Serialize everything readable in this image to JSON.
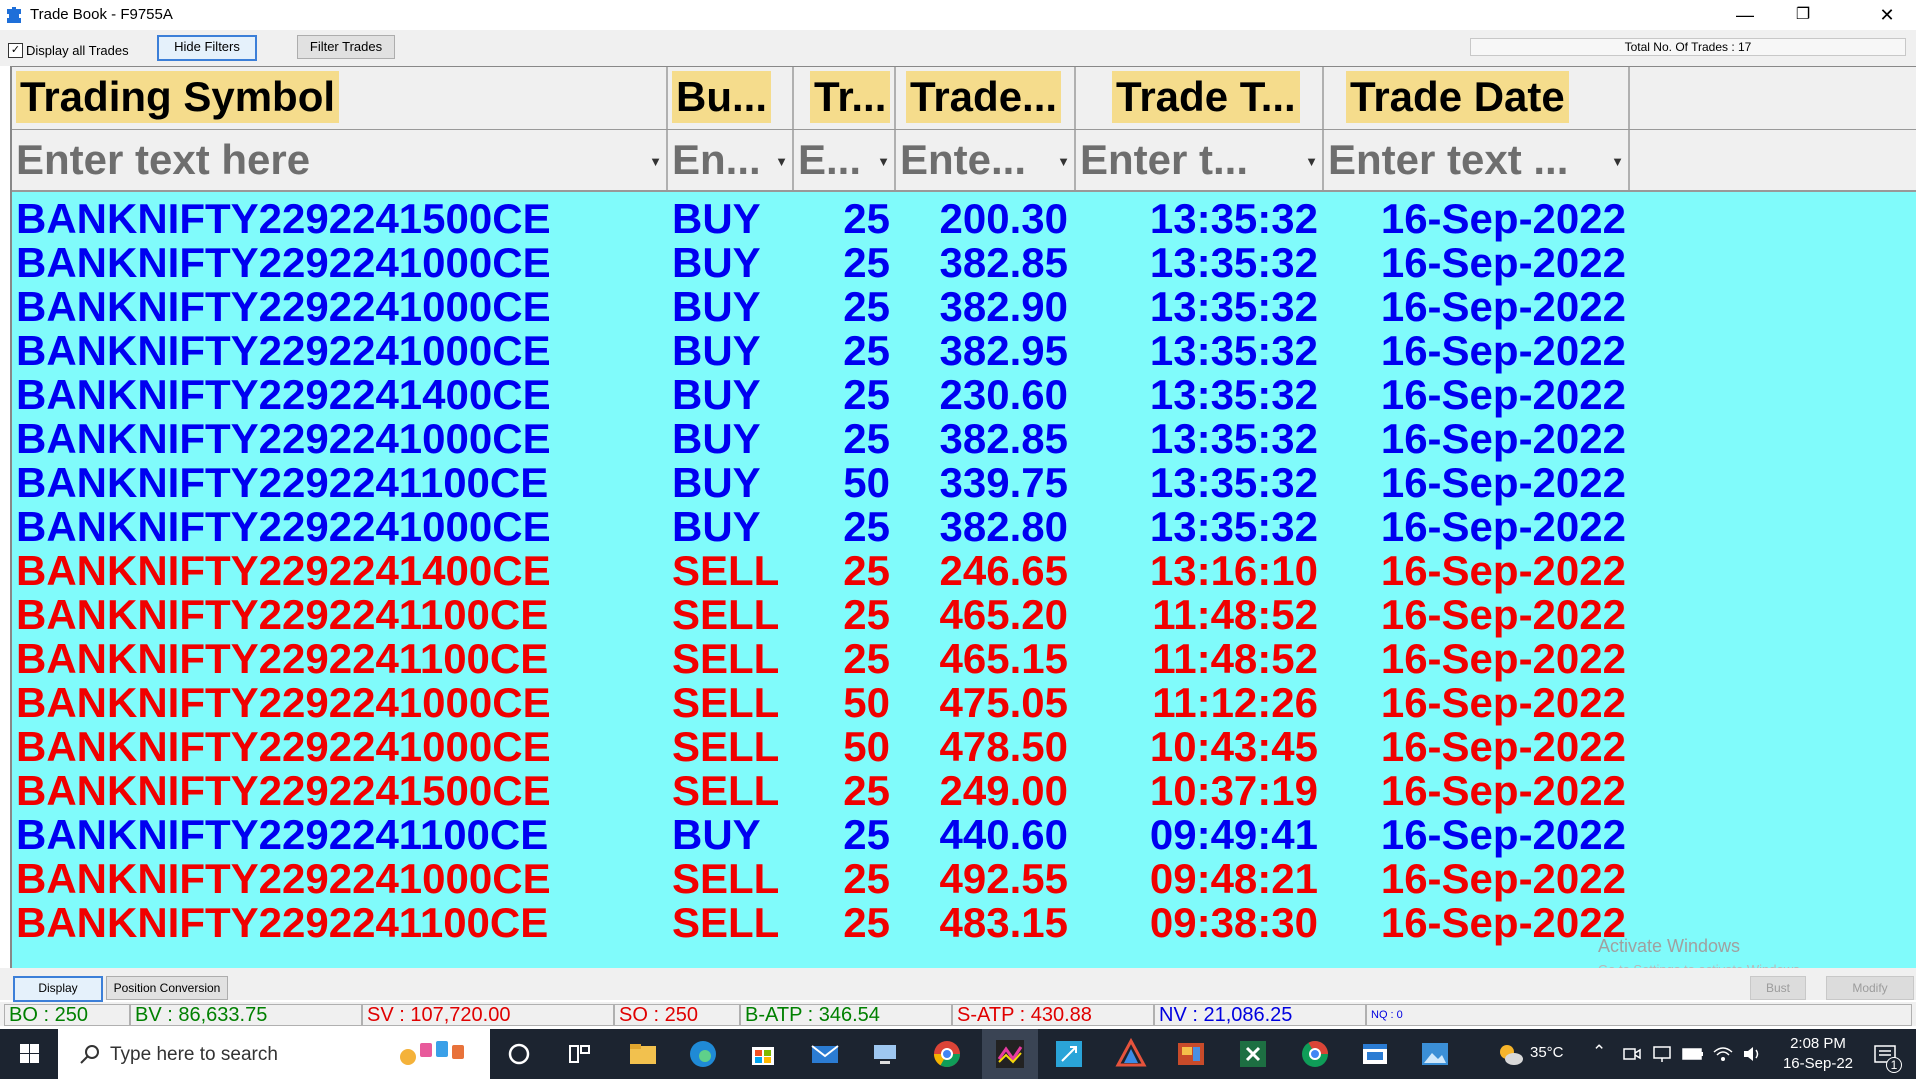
{
  "window": {
    "title": "Trade Book - F9755A",
    "minimize_glyph": "—",
    "maximize_glyph": "❐",
    "close_glyph": "✕"
  },
  "toolbar": {
    "display_all_label": "Display all Trades",
    "display_all_checked": true,
    "hide_filters_label": "Hide Filters",
    "filter_trades_label": "Filter Trades",
    "total_trades_text": "Total No. Of Trades : 17"
  },
  "columns": [
    {
      "header": "Trading Symbol",
      "filter_placeholder": "Enter text here"
    },
    {
      "header": "Bu...",
      "filter_placeholder": "En..."
    },
    {
      "header": "Tr...",
      "filter_placeholder": "E..."
    },
    {
      "header": "Trade...",
      "filter_placeholder": "Ente..."
    },
    {
      "header": "Trade T...",
      "filter_placeholder": "Enter t..."
    },
    {
      "header": "Trade Date",
      "filter_placeholder": "Enter text ..."
    }
  ],
  "filter_icon": "funnel-icon",
  "rows": [
    {
      "symbol": "BANKNIFTY2292241500CE",
      "side": "BUY",
      "qty": "25",
      "price": "200.30",
      "time": "13:35:32",
      "date": "16-Sep-2022"
    },
    {
      "symbol": "BANKNIFTY2292241000CE",
      "side": "BUY",
      "qty": "25",
      "price": "382.85",
      "time": "13:35:32",
      "date": "16-Sep-2022"
    },
    {
      "symbol": "BANKNIFTY2292241000CE",
      "side": "BUY",
      "qty": "25",
      "price": "382.90",
      "time": "13:35:32",
      "date": "16-Sep-2022"
    },
    {
      "symbol": "BANKNIFTY2292241000CE",
      "side": "BUY",
      "qty": "25",
      "price": "382.95",
      "time": "13:35:32",
      "date": "16-Sep-2022"
    },
    {
      "symbol": "BANKNIFTY2292241400CE",
      "side": "BUY",
      "qty": "25",
      "price": "230.60",
      "time": "13:35:32",
      "date": "16-Sep-2022"
    },
    {
      "symbol": "BANKNIFTY2292241000CE",
      "side": "BUY",
      "qty": "25",
      "price": "382.85",
      "time": "13:35:32",
      "date": "16-Sep-2022"
    },
    {
      "symbol": "BANKNIFTY2292241100CE",
      "side": "BUY",
      "qty": "50",
      "price": "339.75",
      "time": "13:35:32",
      "date": "16-Sep-2022"
    },
    {
      "symbol": "BANKNIFTY2292241000CE",
      "side": "BUY",
      "qty": "25",
      "price": "382.80",
      "time": "13:35:32",
      "date": "16-Sep-2022"
    },
    {
      "symbol": "BANKNIFTY2292241400CE",
      "side": "SELL",
      "qty": "25",
      "price": "246.65",
      "time": "13:16:10",
      "date": "16-Sep-2022"
    },
    {
      "symbol": "BANKNIFTY2292241100CE",
      "side": "SELL",
      "qty": "25",
      "price": "465.20",
      "time": "11:48:52",
      "date": "16-Sep-2022"
    },
    {
      "symbol": "BANKNIFTY2292241100CE",
      "side": "SELL",
      "qty": "25",
      "price": "465.15",
      "time": "11:48:52",
      "date": "16-Sep-2022"
    },
    {
      "symbol": "BANKNIFTY2292241000CE",
      "side": "SELL",
      "qty": "50",
      "price": "475.05",
      "time": "11:12:26",
      "date": "16-Sep-2022"
    },
    {
      "symbol": "BANKNIFTY2292241000CE",
      "side": "SELL",
      "qty": "50",
      "price": "478.50",
      "time": "10:43:45",
      "date": "16-Sep-2022"
    },
    {
      "symbol": "BANKNIFTY2292241500CE",
      "side": "SELL",
      "qty": "25",
      "price": "249.00",
      "time": "10:37:19",
      "date": "16-Sep-2022"
    },
    {
      "symbol": "BANKNIFTY2292241100CE",
      "side": "BUY",
      "qty": "25",
      "price": "440.60",
      "time": "09:49:41",
      "date": "16-Sep-2022"
    },
    {
      "symbol": "BANKNIFTY2292241000CE",
      "side": "SELL",
      "qty": "25",
      "price": "492.55",
      "time": "09:48:21",
      "date": "16-Sep-2022"
    },
    {
      "symbol": "BANKNIFTY2292241100CE",
      "side": "SELL",
      "qty": "25",
      "price": "483.15",
      "time": "09:38:30",
      "date": "16-Sep-2022"
    }
  ],
  "colors": {
    "buy": "#0000f0",
    "sell": "#f00000",
    "grid_background": "#80fbfb",
    "header_label_background": "#f5dc8c"
  },
  "watermark": {
    "line1": "Activate Windows",
    "line2": "Go to Settings to activate Windows."
  },
  "bottom_buttons": {
    "display": "Display",
    "position_conversion": "Position Conversion",
    "bust": "Bust",
    "modify": "Modify"
  },
  "status": {
    "bo": "BO : 250",
    "bv": "BV : 86,633.75",
    "sv": "SV : 107,720.00",
    "so": "SO : 250",
    "batp": "B-ATP : 346.54",
    "satp": "S-ATP : 430.88",
    "nv": "NV : 21,086.25",
    "nq": "NQ : 0"
  },
  "taskbar": {
    "search_placeholder": "Type here to search",
    "weather": "35°C",
    "time": "2:08 PM",
    "date": "16-Sep-22",
    "notification_count": "1",
    "icons": [
      "start-icon",
      "search-icon",
      "cortana-icon",
      "task-view-icon",
      "file-explorer-icon",
      "edge-icon",
      "store-icon",
      "mail-icon",
      "remote-desktop-icon",
      "chrome-icon",
      "trading-app-icon",
      "snipping-tool-icon",
      "arc-icon",
      "media-player-icon",
      "excel-icon",
      "chrome-profile-icon",
      "app-window-icon",
      "photos-icon"
    ]
  }
}
